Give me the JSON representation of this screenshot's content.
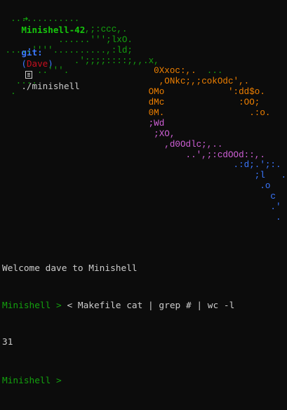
{
  "prompt_line": {
    "arrow": "➜",
    "repo": "Minishell-42",
    "git_label": "git:",
    "paren_open": "(",
    "branch": "Dave",
    "paren_close": ")",
    "dirty_icon": "file-icon",
    "command": "./minishell"
  },
  "ascii_art": [
    [
      {
        "t": "  .............",
        "c": "green"
      }
    ],
    [
      {
        "t": "              ..,;:ccc,.",
        "c": "green"
      }
    ],
    [
      {
        "t": "           ......''';lxO.",
        "c": "green"
      }
    ],
    [
      {
        "t": " .....''''..........,:ld;",
        "c": "green"
      }
    ],
    [
      {
        "t": "              .';;;;::::;,,.x,",
        "c": "green"
      }
    ],
    [
      {
        "t": "       ..'''.",
        "c": "green"
      },
      {
        "t": "                0Xxoc:,.",
        "c": "orange"
      },
      {
        "t": "  ...",
        "c": "green"
      }
    ],
    [
      {
        "t": "   ....",
        "c": "green"
      },
      {
        "t": "                       ,ONkc;,;cokOdc',.",
        "c": "orange"
      }
    ],
    [
      {
        "t": "  .",
        "c": "green"
      },
      {
        "t": "                         OMo",
        "c": "orange"
      },
      {
        "t": "            ':dd$o.",
        "c": "orange"
      }
    ],
    [
      {
        "t": "                            dMc",
        "c": "orange"
      },
      {
        "t": "              :OO;",
        "c": "orange"
      }
    ],
    [
      {
        "t": "                            0M.",
        "c": "orange"
      },
      {
        "t": "                .:o.",
        "c": "orange"
      }
    ],
    [
      {
        "t": "                            ;Wd",
        "c": "magenta"
      }
    ],
    [
      {
        "t": "                             ;XO,",
        "c": "magenta"
      }
    ],
    [
      {
        "t": "                               ,d0Odlc;,..",
        "c": "magenta"
      }
    ],
    [
      {
        "t": "                                   ..',;:cdOOd::,.",
        "c": "magenta"
      }
    ],
    [
      {
        "t": "                                            .:d;.';:.",
        "c": "blue"
      }
    ],
    [
      {
        "t": "                                                ;l   ..",
        "c": "blue"
      }
    ],
    [
      {
        "t": "                                                 .o",
        "c": "blue"
      }
    ],
    [
      {
        "t": "                                                   c",
        "c": "blue"
      }
    ],
    [
      {
        "t": "                                                   .'",
        "c": "blue"
      }
    ],
    [
      {
        "t": "                                                    .",
        "c": "blue"
      }
    ]
  ],
  "welcome": "Welcome dave to Minishell",
  "command_prompt": "Minishell > ",
  "command_input": "< Makefile cat | grep # | wc -l",
  "command_output": "31",
  "final_prompt": "Minishell > ",
  "colors": {
    "background": "#0c0c0c",
    "text": "#cccccc",
    "green": "#13a10e",
    "bright_green": "#16c60c",
    "blue": "#3b78ff",
    "red": "#c50f1f",
    "orange": "#f08000",
    "magenta": "#d060d8"
  }
}
